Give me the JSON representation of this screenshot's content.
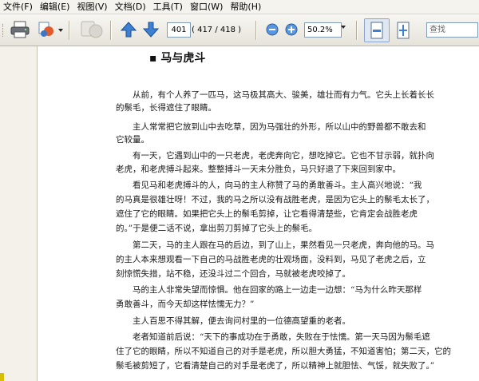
{
  "menubar": [
    "文件(F)",
    "编辑(E)",
    "视图(V)",
    "文档(D)",
    "工具(T)",
    "窗口(W)",
    "帮助(H)"
  ],
  "toolbar": {
    "page_current": "401",
    "page_total": "( 417 / 418 )",
    "zoom": "50.2%",
    "search_placeholder": "查找"
  },
  "document": {
    "title": "马与虎斗",
    "lines": [
      "从前，有个人养了一匹马，这马极其高大、骏美，雄壮而有力气。它头上长着长长",
      "的鬃毛，长得遮住了眼睛。",
      "主人常常把它放到山中去吃草，因为马强壮的外形，所以山中的野兽都不敢去和",
      "它较量。",
      "有一天，它遇到山中的一只老虎，老虎奔向它，想吃掉它。它也不甘示弱，就扑向",
      "老虎，和老虎搏斗起来。整整搏斗一天未分胜负，马只好退了下来回到家中。",
      "看见马和老虎搏斗的人，向马的主人称赞了马的勇敢善斗。主人高兴地说：“我",
      "的马真是很雄壮呀！不过，我的马之所以没有战胜老虎，是因为它头上的鬃毛太长了，",
      "遮住了它的眼睛。如果把它头上的鬃毛剪掉，让它看得清楚些，它肯定会战胜老虎",
      "的。”于是便二话不说，拿出剪刀剪掉了它头上的鬃毛。",
      "第二天，马的主人跟在马的后边，到了山上，果然看见一只老虎，奔向他的马。马",
      "的主人本来想观看一下自己的马战胜老虎的壮观场面，没料到，马见了老虎之后，立",
      "刻惊慌失措，站不稳，还没斗过二个回合，马就被老虎咬掉了。",
      "马的主人非常失望而惊惧。他在回家的路上一边走一边想：“马为什么昨天那样",
      "勇敢善斗，而今天却这样怯懦无力？”",
      "主人百思不得其解，便去询问村里的一位德高望重的老者。",
      "老者知道前后说：“天下的事成功在于勇敢，失败在于怯懦。第一天马因为鬃毛遮",
      "住了它的眼睛，所以不知道自己的对手是老虎，所以胆大勇猛，不知道害怕；第二天，它的",
      "鬃毛被剪短了，它看清楚自己的对手是老虎了，所以精神上就胆怯、气馁，就失败了。”"
    ]
  }
}
